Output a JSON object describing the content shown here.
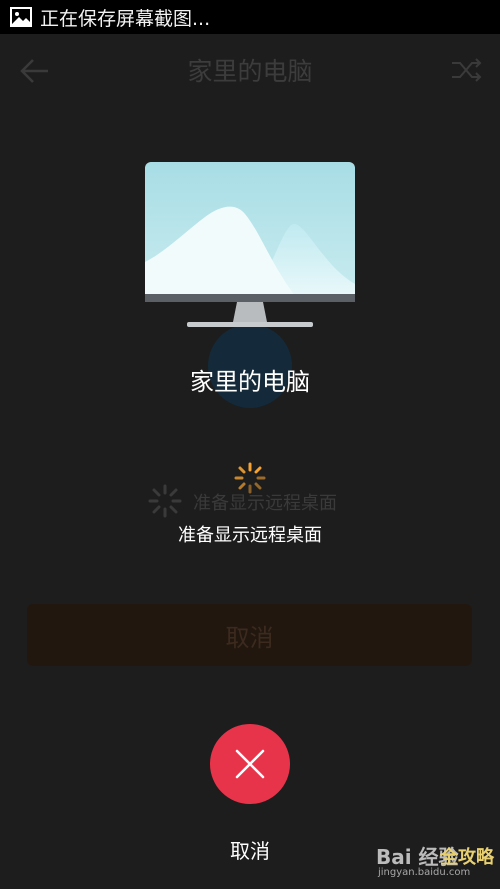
{
  "status_bar": {
    "icon": "image-icon",
    "text": "正在保存屏幕截图..."
  },
  "app": {
    "title": "家里的电脑",
    "status": "准备显示远程桌面",
    "cancel_button": "取消"
  },
  "overlay": {
    "device_name": "家里的电脑",
    "status": "准备显示远程桌面",
    "cancel_label": "取消",
    "accent_color": "#e8344a",
    "spinner_color": "#f4a234"
  },
  "watermark": {
    "logo_text": "Bai  经验",
    "sub_text": "jingyan.baidu.com",
    "brand_text": "全攻略"
  }
}
